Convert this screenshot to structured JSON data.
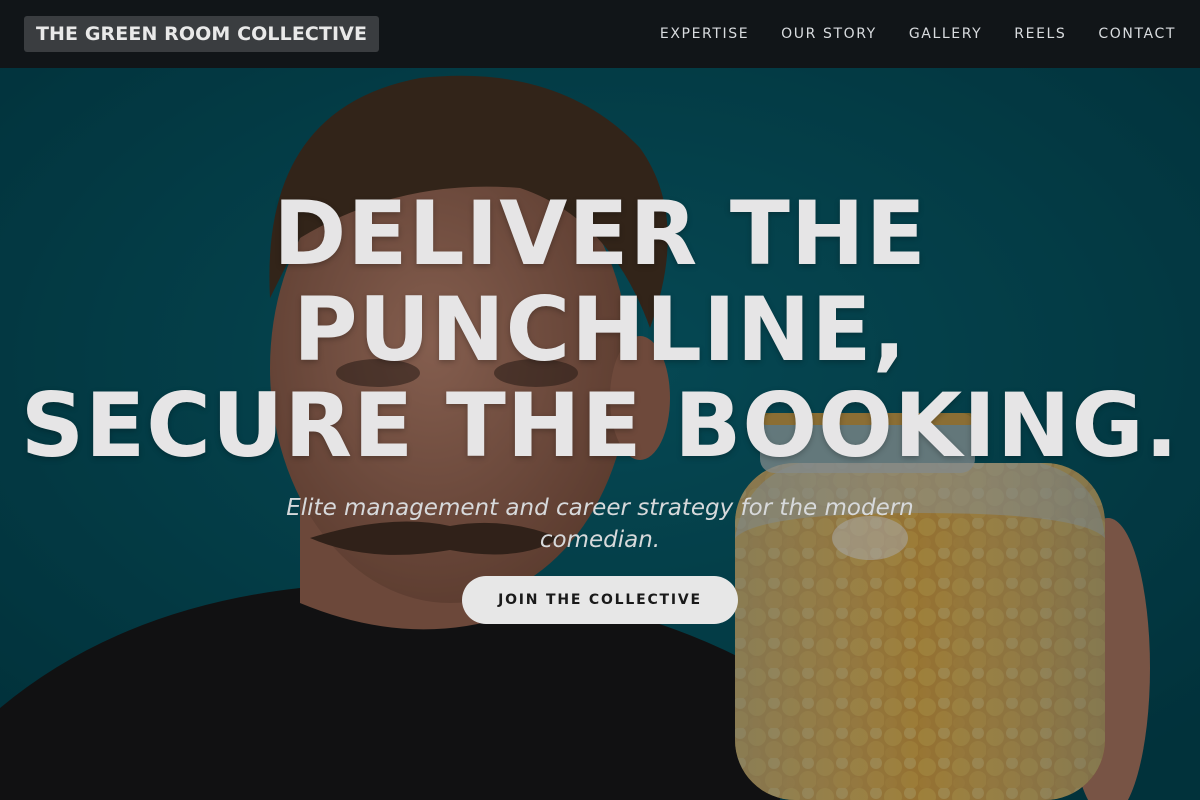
{
  "brand": {
    "name": "THE GREEN ROOM COLLECTIVE"
  },
  "nav": {
    "items": [
      {
        "label": "EXPERTISE"
      },
      {
        "label": "OUR STORY"
      },
      {
        "label": "GALLERY"
      },
      {
        "label": "REELS"
      },
      {
        "label": "CONTACT"
      }
    ]
  },
  "hero": {
    "headline_lines": [
      "DELIVER THE",
      "PUNCHLINE,",
      "SECURE THE BOOKING."
    ],
    "subheadline": "Elite management and career strategy for the modern comedian.",
    "cta_label": "JOIN THE COLLECTIVE",
    "background_image": "comedian-with-candy-jar-photo"
  },
  "colors": {
    "navbar_bg": "#111518",
    "hero_bg": "#075a6a",
    "headline_text": "#e6e5e6",
    "cta_bg": "#e7e7e7",
    "cta_text": "#1a1a1a"
  }
}
